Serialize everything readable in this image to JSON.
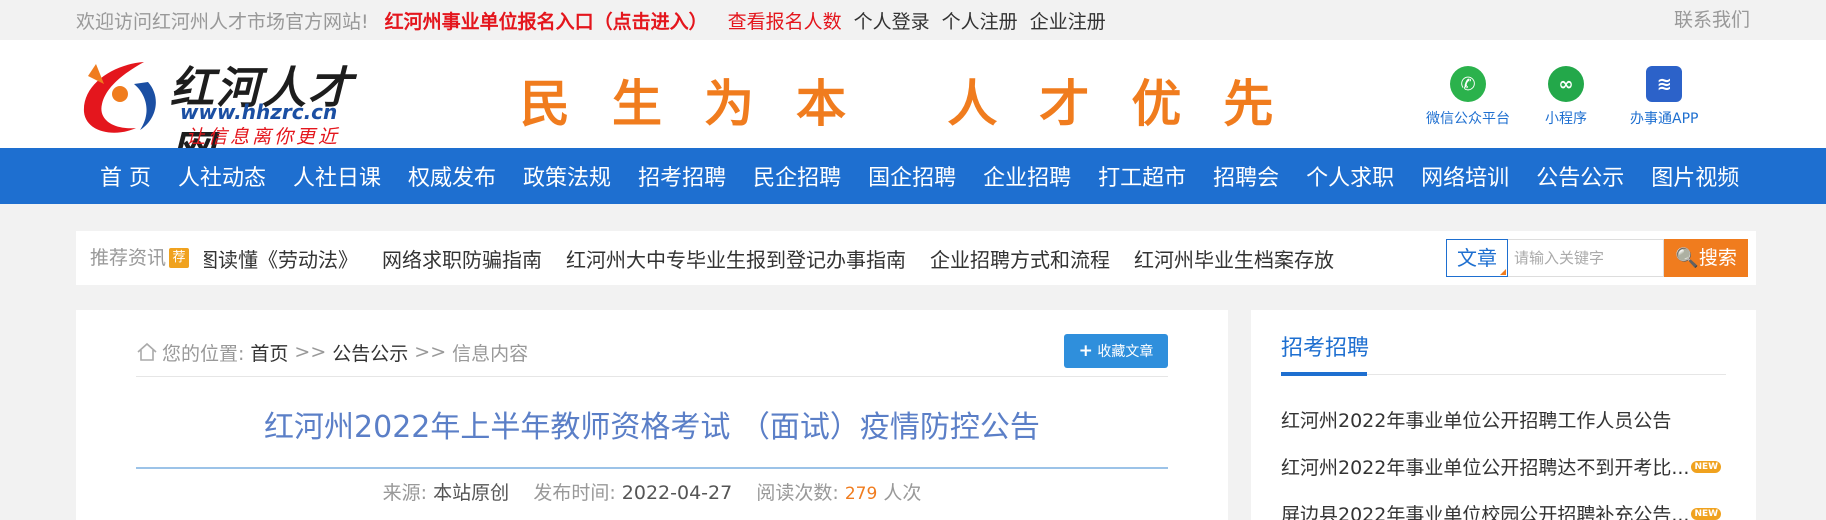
{
  "topbar": {
    "welcome": "欢迎访问红河州人才市场官方网站!",
    "entry": "红河州事业单位报名入口（点击进入）",
    "count": "查看报名人数",
    "login": "个人登录",
    "register": "个人注册",
    "company_register": "企业注册",
    "contact": "联系我们"
  },
  "logo": {
    "name": "红河人才网",
    "url": "www.hhzrc.cn",
    "slogan": "让信息离你更近"
  },
  "banner_slogan": "民生为本 人才优先",
  "qr_links": [
    {
      "label": "微信公众平台",
      "icon": "wechat-icon",
      "color": "#2bb24c"
    },
    {
      "label": "小程序",
      "icon": "mini-program-icon",
      "color": "#23a84a"
    },
    {
      "label": "办事通APP",
      "icon": "app-icon",
      "color": "#2c62c9"
    }
  ],
  "nav": [
    "首 页",
    "人社动态",
    "人社日课",
    "权威发布",
    "政策法规",
    "招考招聘",
    "民企招聘",
    "国企招聘",
    "企业招聘",
    "打工超市",
    "招聘会",
    "个人求职",
    "网络培训",
    "公告公示",
    "图片视频"
  ],
  "recommend": {
    "title": "推荐资讯",
    "badge": "荐",
    "items": [
      "图读懂《劳动法》",
      "网络求职防骗指南",
      "红河州大中专毕业生报到登记办事指南",
      "企业招聘方式和流程",
      "红河州毕业生档案存放"
    ]
  },
  "search": {
    "type": "文章",
    "placeholder": "请输入关键字",
    "button": "搜索"
  },
  "breadcrumb": {
    "prefix": "您的位置:",
    "home": "首页",
    "sep": ">>",
    "section": "公告公示",
    "current": "信息内容"
  },
  "favorite_button": "收藏文章",
  "article": {
    "title": "红河州2022年上半年教师资格考试 （面试）疫情防控公告",
    "source_label": "来源:",
    "source": "本站原创",
    "date_label": "发布时间:",
    "date": "2022-04-27",
    "views_label": "阅读次数:",
    "views": "279",
    "views_unit": "人次"
  },
  "sidebar": {
    "title": "招考招聘",
    "items": [
      {
        "text": "红河州2022年事业单位公开招聘工作人员公告",
        "new": false
      },
      {
        "text": "红河州2022年事业单位公开招聘达不到开考比...",
        "new": true
      },
      {
        "text": "屏边县2022年事业单位校园公开招聘补充公告...",
        "new": true
      }
    ],
    "new_badge": "NEW"
  }
}
